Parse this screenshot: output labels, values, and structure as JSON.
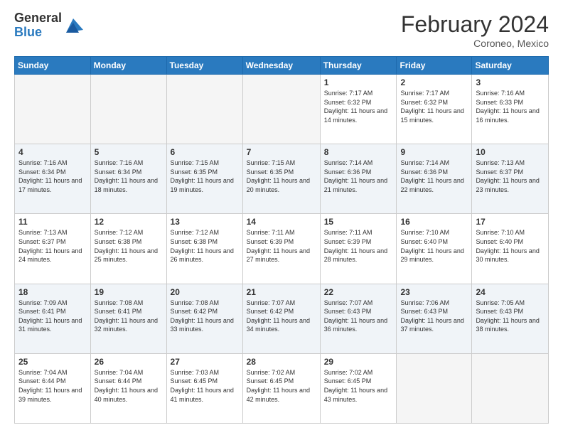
{
  "header": {
    "logo_general": "General",
    "logo_blue": "Blue",
    "month_title": "February 2024",
    "location": "Coroneo, Mexico"
  },
  "days_of_week": [
    "Sunday",
    "Monday",
    "Tuesday",
    "Wednesday",
    "Thursday",
    "Friday",
    "Saturday"
  ],
  "weeks": [
    [
      {
        "day": "",
        "info": ""
      },
      {
        "day": "",
        "info": ""
      },
      {
        "day": "",
        "info": ""
      },
      {
        "day": "",
        "info": ""
      },
      {
        "day": "1",
        "info": "Sunrise: 7:17 AM\nSunset: 6:32 PM\nDaylight: 11 hours and 14 minutes."
      },
      {
        "day": "2",
        "info": "Sunrise: 7:17 AM\nSunset: 6:32 PM\nDaylight: 11 hours and 15 minutes."
      },
      {
        "day": "3",
        "info": "Sunrise: 7:16 AM\nSunset: 6:33 PM\nDaylight: 11 hours and 16 minutes."
      }
    ],
    [
      {
        "day": "4",
        "info": "Sunrise: 7:16 AM\nSunset: 6:34 PM\nDaylight: 11 hours and 17 minutes."
      },
      {
        "day": "5",
        "info": "Sunrise: 7:16 AM\nSunset: 6:34 PM\nDaylight: 11 hours and 18 minutes."
      },
      {
        "day": "6",
        "info": "Sunrise: 7:15 AM\nSunset: 6:35 PM\nDaylight: 11 hours and 19 minutes."
      },
      {
        "day": "7",
        "info": "Sunrise: 7:15 AM\nSunset: 6:35 PM\nDaylight: 11 hours and 20 minutes."
      },
      {
        "day": "8",
        "info": "Sunrise: 7:14 AM\nSunset: 6:36 PM\nDaylight: 11 hours and 21 minutes."
      },
      {
        "day": "9",
        "info": "Sunrise: 7:14 AM\nSunset: 6:36 PM\nDaylight: 11 hours and 22 minutes."
      },
      {
        "day": "10",
        "info": "Sunrise: 7:13 AM\nSunset: 6:37 PM\nDaylight: 11 hours and 23 minutes."
      }
    ],
    [
      {
        "day": "11",
        "info": "Sunrise: 7:13 AM\nSunset: 6:37 PM\nDaylight: 11 hours and 24 minutes."
      },
      {
        "day": "12",
        "info": "Sunrise: 7:12 AM\nSunset: 6:38 PM\nDaylight: 11 hours and 25 minutes."
      },
      {
        "day": "13",
        "info": "Sunrise: 7:12 AM\nSunset: 6:38 PM\nDaylight: 11 hours and 26 minutes."
      },
      {
        "day": "14",
        "info": "Sunrise: 7:11 AM\nSunset: 6:39 PM\nDaylight: 11 hours and 27 minutes."
      },
      {
        "day": "15",
        "info": "Sunrise: 7:11 AM\nSunset: 6:39 PM\nDaylight: 11 hours and 28 minutes."
      },
      {
        "day": "16",
        "info": "Sunrise: 7:10 AM\nSunset: 6:40 PM\nDaylight: 11 hours and 29 minutes."
      },
      {
        "day": "17",
        "info": "Sunrise: 7:10 AM\nSunset: 6:40 PM\nDaylight: 11 hours and 30 minutes."
      }
    ],
    [
      {
        "day": "18",
        "info": "Sunrise: 7:09 AM\nSunset: 6:41 PM\nDaylight: 11 hours and 31 minutes."
      },
      {
        "day": "19",
        "info": "Sunrise: 7:08 AM\nSunset: 6:41 PM\nDaylight: 11 hours and 32 minutes."
      },
      {
        "day": "20",
        "info": "Sunrise: 7:08 AM\nSunset: 6:42 PM\nDaylight: 11 hours and 33 minutes."
      },
      {
        "day": "21",
        "info": "Sunrise: 7:07 AM\nSunset: 6:42 PM\nDaylight: 11 hours and 34 minutes."
      },
      {
        "day": "22",
        "info": "Sunrise: 7:07 AM\nSunset: 6:43 PM\nDaylight: 11 hours and 36 minutes."
      },
      {
        "day": "23",
        "info": "Sunrise: 7:06 AM\nSunset: 6:43 PM\nDaylight: 11 hours and 37 minutes."
      },
      {
        "day": "24",
        "info": "Sunrise: 7:05 AM\nSunset: 6:43 PM\nDaylight: 11 hours and 38 minutes."
      }
    ],
    [
      {
        "day": "25",
        "info": "Sunrise: 7:04 AM\nSunset: 6:44 PM\nDaylight: 11 hours and 39 minutes."
      },
      {
        "day": "26",
        "info": "Sunrise: 7:04 AM\nSunset: 6:44 PM\nDaylight: 11 hours and 40 minutes."
      },
      {
        "day": "27",
        "info": "Sunrise: 7:03 AM\nSunset: 6:45 PM\nDaylight: 11 hours and 41 minutes."
      },
      {
        "day": "28",
        "info": "Sunrise: 7:02 AM\nSunset: 6:45 PM\nDaylight: 11 hours and 42 minutes."
      },
      {
        "day": "29",
        "info": "Sunrise: 7:02 AM\nSunset: 6:45 PM\nDaylight: 11 hours and 43 minutes."
      },
      {
        "day": "",
        "info": ""
      },
      {
        "day": "",
        "info": ""
      }
    ]
  ]
}
